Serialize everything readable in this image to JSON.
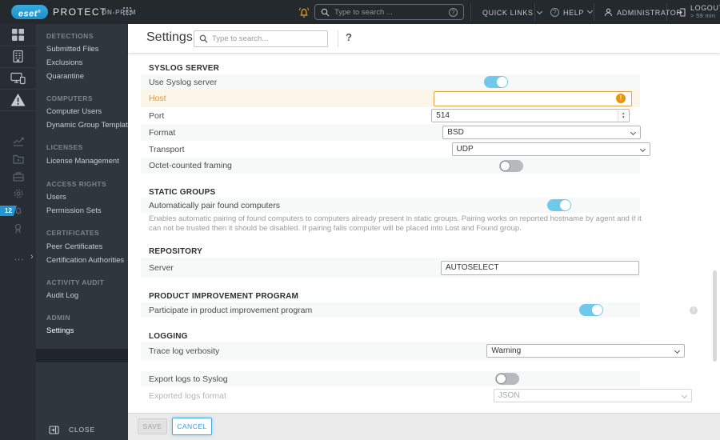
{
  "topbar": {
    "logo": "eset",
    "product": "PROTECT",
    "edition": "ON-PREM",
    "search_placeholder": "Type to search ...",
    "quick_links_label": "QUICK LINKS",
    "help_label": "HELP",
    "user_label": "ADMINISTRATOR",
    "logout_label": "LOGOUT",
    "logout_timer": "> 59 min"
  },
  "sidebar": {
    "badge_count": "12",
    "more_dots": "...",
    "expand_arrow": "›",
    "close_label": "CLOSE",
    "rail_icons": [
      "dashboard-icon",
      "computers-icon",
      "devices-icon",
      "detections-icon",
      "reports-icon",
      "tasks-icon",
      "installers-icon",
      "policies-icon",
      "notifications-icon",
      "status-icon"
    ],
    "sections": [
      {
        "header": "DETECTIONS",
        "items": [
          "Submitted Files",
          "Exclusions",
          "Quarantine"
        ]
      },
      {
        "header": "COMPUTERS",
        "items": [
          "Computer Users",
          "Dynamic Group Templates"
        ]
      },
      {
        "header": "LICENSES",
        "items": [
          "License Management"
        ]
      },
      {
        "header": "ACCESS RIGHTS",
        "items": [
          "Users",
          "Permission Sets"
        ]
      },
      {
        "header": "CERTIFICATES",
        "items": [
          "Peer Certificates",
          "Certification Authorities"
        ]
      },
      {
        "header": "ACTIVITY AUDIT",
        "items": [
          "Audit Log"
        ]
      },
      {
        "header": "ADMIN",
        "items": [
          "Settings"
        ],
        "selected_item": "Settings"
      }
    ]
  },
  "page": {
    "title": "Settings",
    "search_placeholder": "Type to search...",
    "help_glyph": "?"
  },
  "content": {
    "syslog": {
      "header": "SYSLOG SERVER",
      "use_label": "Use Syslog server",
      "use_state": "on",
      "host_label": "Host",
      "host_value": "",
      "port_label": "Port",
      "port_value": "514",
      "format_label": "Format",
      "format_value": "BSD",
      "transport_label": "Transport",
      "transport_value": "UDP",
      "octet_label": "Octet-counted framing",
      "octet_state": "off",
      "host_warning_glyph": "!"
    },
    "static_groups": {
      "header": "STATIC GROUPS",
      "pair_label": "Automatically pair found computers",
      "pair_state": "on",
      "description": "Enables automatic pairing of found computers to computers already present in static groups. Pairing works on reported hostname by agent and if it can not be trusted then it should be disabled. If pairing fails computer will be placed into Lost and Found group."
    },
    "repository": {
      "header": "REPOSITORY",
      "server_label": "Server",
      "server_value": "AUTOSELECT"
    },
    "improvement": {
      "header": "PRODUCT IMPROVEMENT PROGRAM",
      "participate_label": "Participate in product improvement program",
      "participate_state": "on",
      "info_glyph": "i"
    },
    "logging": {
      "header": "LOGGING",
      "verbosity_label": "Trace log verbosity",
      "verbosity_value": "Warning",
      "export_label": "Export logs to Syslog",
      "export_state": "off",
      "format_label": "Exported logs format",
      "format_value": "JSON"
    }
  },
  "footer": {
    "save_label": "SAVE",
    "cancel_label": "CANCEL"
  },
  "colors": {
    "accent_blue": "#2da7dc",
    "toggle_on": "#70c8eb",
    "warning_orange": "#e8940c",
    "host_row_highlight": "#fbf6e7",
    "topbar_bg": "#24292e",
    "rail_bg": "#272d33",
    "menu_bg": "#2f363d",
    "selected_item_bg": "#1f252a",
    "bell_gold": "#d49c1e"
  }
}
